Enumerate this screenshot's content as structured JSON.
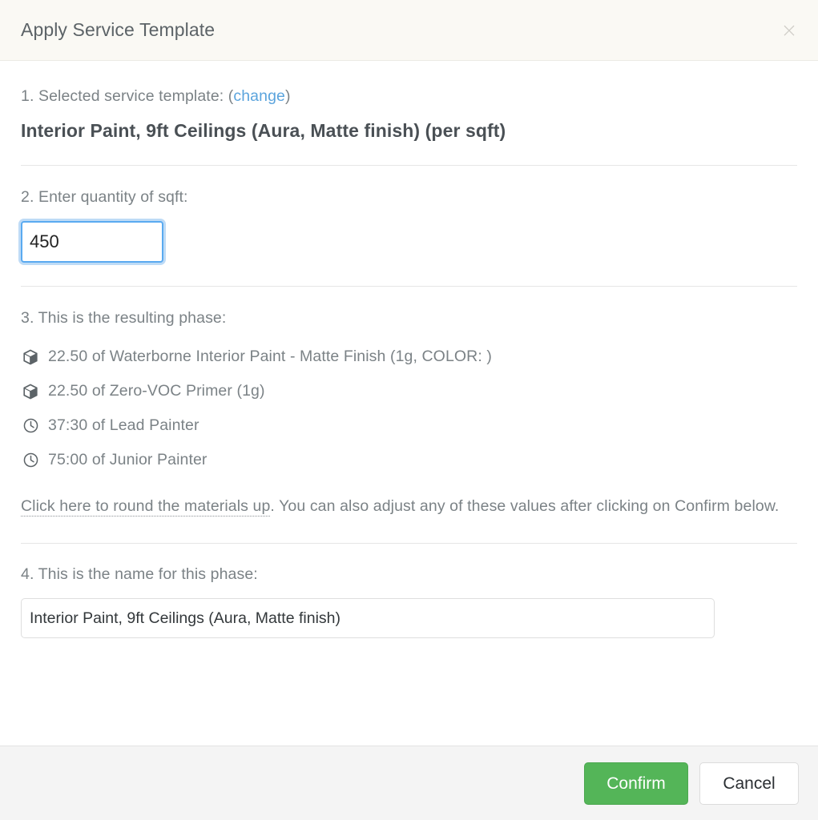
{
  "header": {
    "title": "Apply Service Template",
    "close_label": "×"
  },
  "step1": {
    "label_prefix": "1. Selected service template: ",
    "paren_open": "(",
    "change_link": "change",
    "paren_close": ")",
    "template_name": "Interior Paint, 9ft Ceilings (Aura, Matte finish) (per sqft)"
  },
  "step2": {
    "label": "2. Enter quantity of sqft:",
    "value": "450",
    "placeholder": ""
  },
  "step3": {
    "label": "3. This is the resulting phase:",
    "items": [
      {
        "icon": "box-icon",
        "text": "22.50 of Waterborne Interior Paint - Matte Finish (1g, COLOR: )"
      },
      {
        "icon": "box-icon",
        "text": "22.50 of Zero-VOC Primer (1g)"
      },
      {
        "icon": "clock-icon",
        "text": "37:30 of Lead Painter"
      },
      {
        "icon": "clock-icon",
        "text": "75:00 of Junior Painter"
      }
    ],
    "round_link": "Click here to round the materials up",
    "round_note": ". You can also adjust any of these values after clicking on Confirm below."
  },
  "step4": {
    "label": "4. This is the name for this phase:",
    "value": "Interior Paint, 9ft Ceilings (Aura, Matte finish)",
    "placeholder": ""
  },
  "footer": {
    "confirm_label": "Confirm",
    "cancel_label": "Cancel"
  },
  "colors": {
    "accent_green": "#54b558",
    "link_blue": "#5ba4dd",
    "focus_blue": "#5aaaf0",
    "header_bg": "#faf9f4",
    "footer_bg": "#f4f4f4",
    "text_gray": "#7b8286"
  }
}
